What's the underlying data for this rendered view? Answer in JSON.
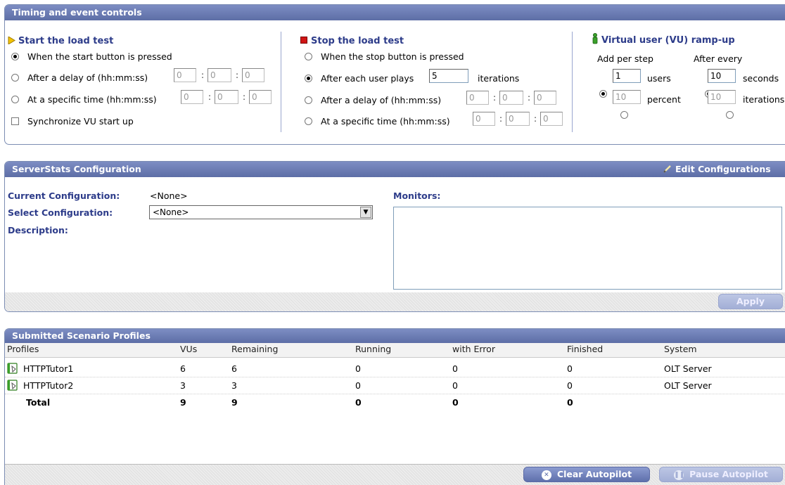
{
  "timing": {
    "header": "Timing and event controls",
    "start": {
      "title": "Start the load test",
      "opt_button": "When the start button is pressed",
      "opt_delay": "After a delay of (hh:mm:ss)",
      "opt_time": "At a specific time (hh:mm:ss)",
      "sync": "Synchronize VU start up",
      "delay_h": "0",
      "delay_m": "0",
      "delay_s": "0",
      "time_h": "0",
      "time_m": "0",
      "time_s": "0"
    },
    "stop": {
      "title": "Stop the load test",
      "opt_button": "When the stop button is pressed",
      "opt_iter": "After each user plays",
      "iter_value": "5",
      "iter_suffix": "iterations",
      "opt_delay": "After a delay of (hh:mm:ss)",
      "opt_time": "At a specific time (hh:mm:ss)",
      "delay_h": "0",
      "delay_m": "0",
      "delay_s": "0",
      "time_h": "0",
      "time_m": "0",
      "time_s": "0"
    },
    "rampup": {
      "title": "Virtual user (VU) ramp-up",
      "add_label": "Add per step",
      "after_label": "After every",
      "users_value": "1",
      "users_label": "users",
      "percent_value": "10",
      "percent_label": "percent",
      "seconds_value": "10",
      "seconds_label": "seconds",
      "iter_value": "10",
      "iter_label": "iterations"
    },
    "separator": ":"
  },
  "serverstats": {
    "header": "ServerStats Configuration",
    "edit": "Edit Configurations",
    "current_label": "Current Configuration:",
    "current_value": "<None>",
    "select_label": "Select Configuration:",
    "select_value": "<None>",
    "description_label": "Description:",
    "monitors_label": "Monitors:",
    "apply": "Apply"
  },
  "scenarios": {
    "header": "Submitted Scenario Profiles",
    "columns": [
      "Profiles",
      "VUs",
      "Remaining",
      "Running",
      "with Error",
      "Finished",
      "System"
    ],
    "rows": [
      [
        "HTTPTutor1",
        "6",
        "6",
        "0",
        "0",
        "0",
        "OLT Server"
      ],
      [
        "HTTPTutor2",
        "3",
        "3",
        "0",
        "0",
        "0",
        "OLT Server"
      ]
    ],
    "total": [
      "Total",
      "9",
      "9",
      "0",
      "0",
      "0"
    ],
    "clear_btn": "Clear Autopilot",
    "pause_btn": "Pause Autopilot"
  },
  "colors": {
    "header_bg": "#6a7bb2",
    "title_text": "#2d3c8a",
    "start_icon": "#e8b400",
    "stop_icon": "#cc1111",
    "vu_icon": "#3aa02a"
  },
  "icons": {
    "start": "play-triangle-icon",
    "stop": "stop-square-icon",
    "rampup": "user-icon",
    "edit": "pencil-icon",
    "profile": "script-document-icon",
    "clear": "close-circle-icon",
    "pause": "pause-circle-icon"
  }
}
